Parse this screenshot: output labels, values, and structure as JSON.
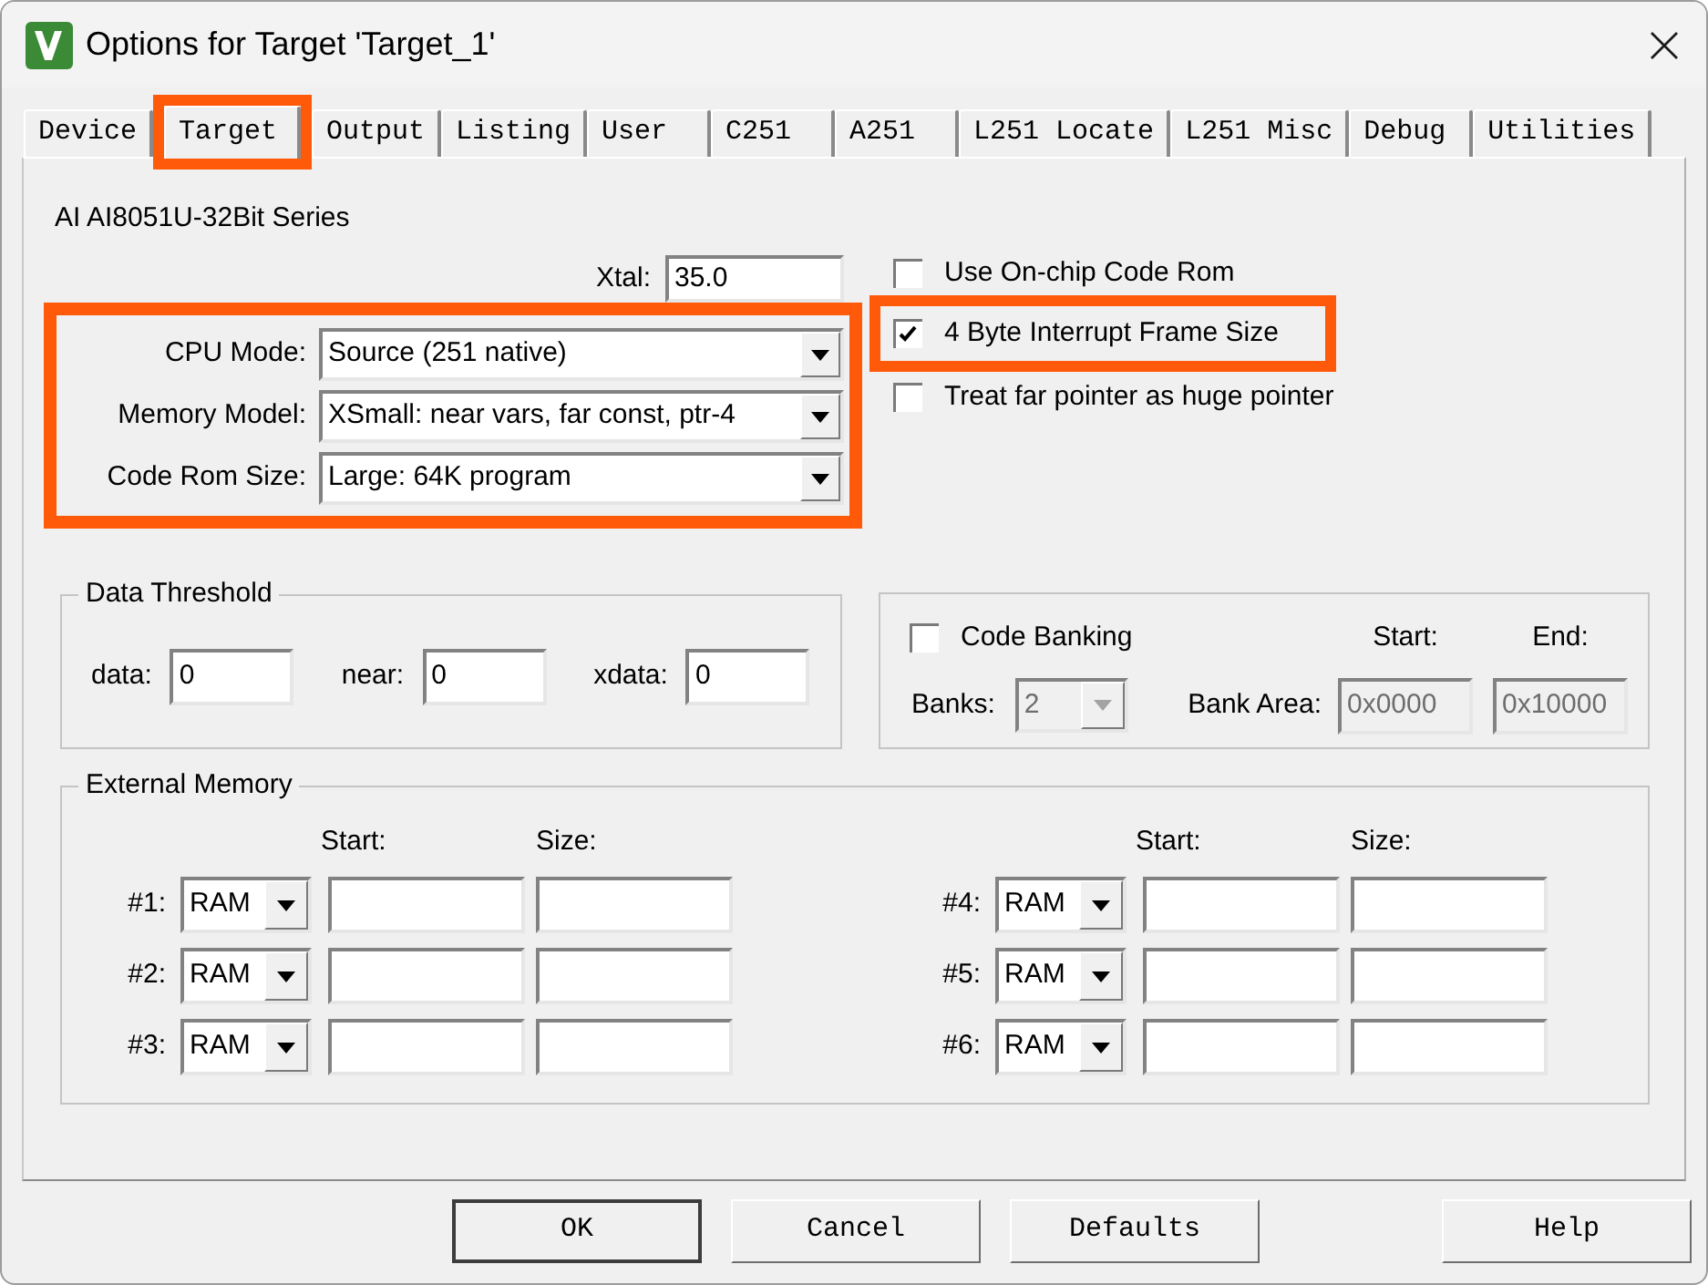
{
  "window": {
    "title": "Options for Target 'Target_1'"
  },
  "tabs": [
    {
      "label": "Device",
      "selected": false,
      "highlighted": false
    },
    {
      "label": "Target",
      "selected": true,
      "highlighted": true
    },
    {
      "label": "Output",
      "selected": false,
      "highlighted": false
    },
    {
      "label": "Listing",
      "selected": false,
      "highlighted": false
    },
    {
      "label": "User",
      "selected": false,
      "highlighted": false
    },
    {
      "label": "C251",
      "selected": false,
      "highlighted": false
    },
    {
      "label": "A251",
      "selected": false,
      "highlighted": false
    },
    {
      "label": "L251 Locate",
      "selected": false,
      "highlighted": false
    },
    {
      "label": "L251 Misc",
      "selected": false,
      "highlighted": false
    },
    {
      "label": "Debug",
      "selected": false,
      "highlighted": false
    },
    {
      "label": "Utilities",
      "selected": false,
      "highlighted": false
    }
  ],
  "device": "AI AI8051U-32Bit Series",
  "xtal": {
    "label": "Xtal:",
    "value": "35.0"
  },
  "cpu_settings": {
    "highlighted": true,
    "rows": [
      {
        "label": "CPU Mode:",
        "value": "Source (251 native)"
      },
      {
        "label": "Memory Model:",
        "value": "XSmall: near vars, far const, ptr-4"
      },
      {
        "label": "Code Rom Size:",
        "value": "Large: 64K program"
      }
    ]
  },
  "options": [
    {
      "label": "Use On-chip Code Rom",
      "checked": false,
      "highlighted": false
    },
    {
      "label": "4 Byte Interrupt Frame Size",
      "checked": true,
      "highlighted": true
    },
    {
      "label": "Treat far pointer as huge pointer",
      "checked": false,
      "highlighted": false
    }
  ],
  "data_threshold": {
    "title": "Data Threshold",
    "fields": [
      {
        "label": "data:",
        "value": "0"
      },
      {
        "label": "near:",
        "value": "0"
      },
      {
        "label": "xdata:",
        "value": "0"
      }
    ]
  },
  "code_banking": {
    "label": "Code Banking",
    "checked": false,
    "start_label": "Start:",
    "end_label": "End:",
    "banks_label": "Banks:",
    "banks": {
      "value": "2",
      "disabled": true
    },
    "bank_area_label": "Bank Area:",
    "start": {
      "value": "0x0000",
      "disabled": true
    },
    "end": {
      "value": "0x10000",
      "disabled": true
    }
  },
  "external_memory": {
    "title": "External Memory",
    "columns": [
      {
        "start_label": "Start:",
        "size_label": "Size:",
        "rows": [
          {
            "label": "#1:",
            "type": "RAM"
          },
          {
            "label": "#2:",
            "type": "RAM"
          },
          {
            "label": "#3:",
            "type": "RAM"
          }
        ]
      },
      {
        "start_label": "Start:",
        "size_label": "Size:",
        "rows": [
          {
            "label": "#4:",
            "type": "RAM"
          },
          {
            "label": "#5:",
            "type": "RAM"
          },
          {
            "label": "#6:",
            "type": "RAM"
          }
        ]
      }
    ]
  },
  "buttons": [
    {
      "label": "OK",
      "default": true
    },
    {
      "label": "Cancel",
      "default": false
    },
    {
      "label": "Defaults",
      "default": false
    },
    {
      "label": "Help",
      "default": false
    }
  ]
}
